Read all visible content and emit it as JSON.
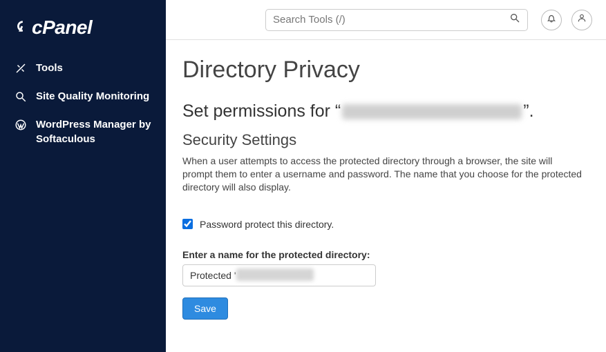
{
  "brand": "cPanel",
  "sidebar": {
    "items": [
      {
        "label": "Tools"
      },
      {
        "label": "Site Quality Monitoring"
      },
      {
        "label": "WordPress Manager by Softaculous"
      }
    ]
  },
  "search": {
    "placeholder": "Search Tools (/)"
  },
  "page": {
    "title": "Directory Privacy",
    "set_permissions_prefix": "Set permissions for “",
    "set_permissions_suffix": "”.",
    "security_heading": "Security Settings",
    "security_desc": "When a user attempts to access the protected directory through a browser, the site will prompt them to enter a username and password. The name that you choose for the protected directory will also display.",
    "checkbox_label": "Password protect this directory.",
    "checkbox_checked": true,
    "name_field_label": "Enter a name for the protected directory:",
    "name_field_value": "Protected '                       '",
    "save_label": "Save"
  }
}
